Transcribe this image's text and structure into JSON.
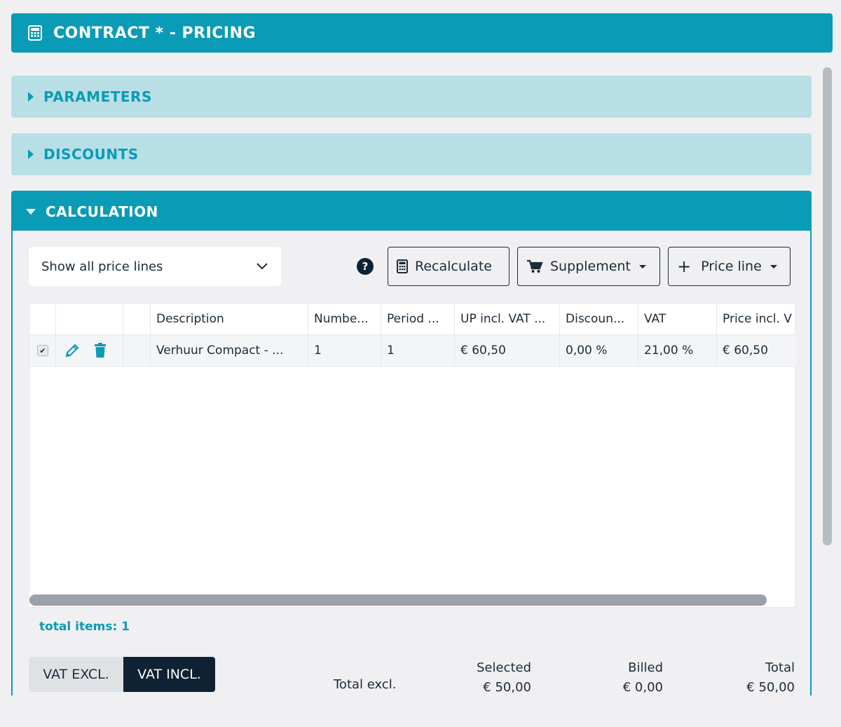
{
  "header": {
    "title": "CONTRACT * - PRICING",
    "icon": "calculator-icon"
  },
  "panels": {
    "parameters": {
      "label": "PARAMETERS",
      "expanded": false
    },
    "discounts": {
      "label": "DISCOUNTS",
      "expanded": false
    },
    "calculation": {
      "label": "CALCULATION",
      "expanded": true
    }
  },
  "toolbar": {
    "filter": {
      "selected": "Show all price lines"
    },
    "help_symbol": "?",
    "recalculate_label": "Recalculate",
    "supplement_label": "Supplement",
    "price_line_label": "Price line",
    "plus_symbol": "+"
  },
  "grid": {
    "columns": [
      "",
      "",
      "",
      "Description",
      "Numbe...",
      "Period ...",
      "UP incl. VAT ...",
      "Discoun...",
      "VAT",
      "Price incl. V"
    ],
    "rows": [
      {
        "checked": true,
        "description": "Verhuur Compact - ...",
        "number": "1",
        "period": "1",
        "up_incl_vat": "€ 60,50",
        "discount": "0,00 %",
        "vat": "21,00 %",
        "price_incl_vat": "€ 60,50"
      }
    ]
  },
  "footer": {
    "total_items": "total items: 1",
    "vat_excl_label": "VAT EXCL.",
    "vat_incl_label": "VAT INCL.",
    "vat_mode": "incl",
    "totals_label": "Total excl.",
    "selected": {
      "label": "Selected",
      "value": "€ 50,00"
    },
    "billed": {
      "label": "Billed",
      "value": "€ 0,00"
    },
    "total": {
      "label": "Total",
      "value": "€ 50,00"
    }
  },
  "colors": {
    "primary": "#0a9bb6",
    "panel_collapsed": "#b8dfe6",
    "dark": "#0f2233",
    "background": "#f0f0f3"
  }
}
